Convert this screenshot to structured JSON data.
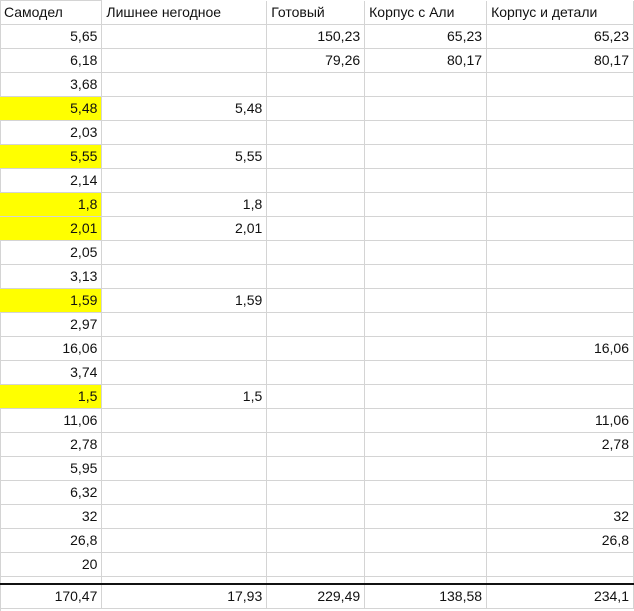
{
  "headers": [
    "Самодел",
    "Лишнее негодное",
    "Готовый",
    "Корпус с Али",
    "Корпус и детали"
  ],
  "rows": [
    {
      "c": [
        "5,65",
        "",
        "150,23",
        "65,23",
        "65,23"
      ],
      "hl": false
    },
    {
      "c": [
        "6,18",
        "",
        "79,26",
        "80,17",
        "80,17"
      ],
      "hl": false
    },
    {
      "c": [
        "3,68",
        "",
        "",
        "",
        ""
      ],
      "hl": false
    },
    {
      "c": [
        "5,48",
        "5,48",
        "",
        "",
        ""
      ],
      "hl": true
    },
    {
      "c": [
        "2,03",
        "",
        "",
        "",
        ""
      ],
      "hl": false
    },
    {
      "c": [
        "5,55",
        "5,55",
        "",
        "",
        ""
      ],
      "hl": true
    },
    {
      "c": [
        "2,14",
        "",
        "",
        "",
        ""
      ],
      "hl": false
    },
    {
      "c": [
        "1,8",
        "1,8",
        "",
        "",
        ""
      ],
      "hl": true
    },
    {
      "c": [
        "2,01",
        "2,01",
        "",
        "",
        ""
      ],
      "hl": true
    },
    {
      "c": [
        "2,05",
        "",
        "",
        "",
        ""
      ],
      "hl": false
    },
    {
      "c": [
        "3,13",
        "",
        "",
        "",
        ""
      ],
      "hl": false
    },
    {
      "c": [
        "1,59",
        "1,59",
        "",
        "",
        ""
      ],
      "hl": true
    },
    {
      "c": [
        "2,97",
        "",
        "",
        "",
        ""
      ],
      "hl": false
    },
    {
      "c": [
        "16,06",
        "",
        "",
        "",
        "16,06"
      ],
      "hl": false
    },
    {
      "c": [
        "3,74",
        "",
        "",
        "",
        ""
      ],
      "hl": false
    },
    {
      "c": [
        "1,5",
        "1,5",
        "",
        "",
        ""
      ],
      "hl": true
    },
    {
      "c": [
        "11,06",
        "",
        "",
        "",
        "11,06"
      ],
      "hl": false
    },
    {
      "c": [
        "2,78",
        "",
        "",
        "",
        "2,78"
      ],
      "hl": false
    },
    {
      "c": [
        "5,95",
        "",
        "",
        "",
        ""
      ],
      "hl": false
    },
    {
      "c": [
        "6,32",
        "",
        "",
        "",
        ""
      ],
      "hl": false
    },
    {
      "c": [
        "32",
        "",
        "",
        "",
        "32"
      ],
      "hl": false
    },
    {
      "c": [
        "26,8",
        "",
        "",
        "",
        "26,8"
      ],
      "hl": false
    },
    {
      "c": [
        "20",
        "",
        "",
        "",
        ""
      ],
      "hl": false
    }
  ],
  "totals": [
    "170,47",
    "17,93",
    "229,49",
    "138,58",
    "234,1"
  ],
  "highlight_color": "#ffff00"
}
